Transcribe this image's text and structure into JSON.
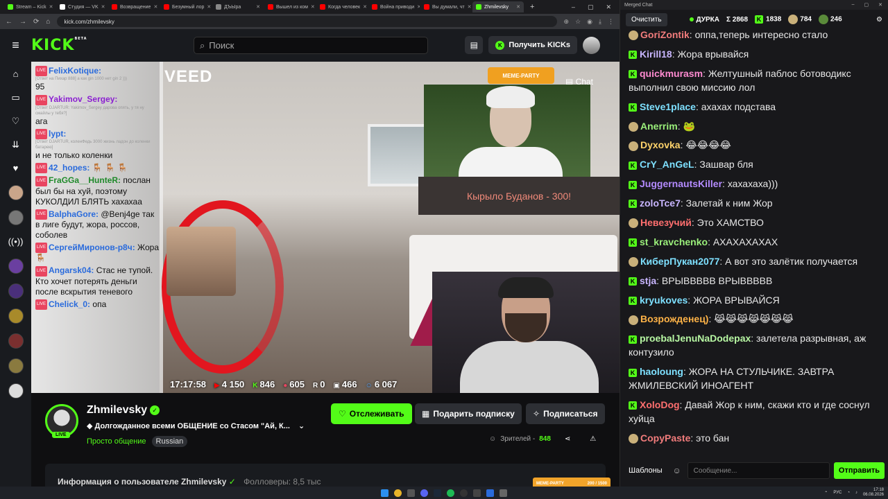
{
  "browser": {
    "tabs": [
      {
        "label": "Stream – Kick",
        "color": "#53fc18"
      },
      {
        "label": "Студия — VK",
        "color": "#ffffff"
      },
      {
        "label": "Возвращение",
        "color": "#ff0000"
      },
      {
        "label": "Безумный лор",
        "color": "#ff0000"
      },
      {
        "label": "ДЪЫра",
        "color": "#888888"
      },
      {
        "label": "Вышел из ком",
        "color": "#ff0000"
      },
      {
        "label": "Когда человек",
        "color": "#ff0000"
      },
      {
        "label": "Война приводи",
        "color": "#ff0000"
      },
      {
        "label": "Вы думали, чт",
        "color": "#ff0000"
      },
      {
        "label": "Zhmilevsky",
        "color": "#53fc18",
        "active": true
      }
    ],
    "url": "kick.com/zhmilevsky"
  },
  "kick": {
    "logo": "KICK",
    "logo_beta": "BETA",
    "search_placeholder": "Поиск",
    "get_kicks_label": "Получить KICKs"
  },
  "player": {
    "watermark": "VEED",
    "meme_party": "MEME-PARTY",
    "chat_label": "Chat",
    "caption": "Кырыло Буданов - 300!",
    "stats": {
      "time": "17:17:58",
      "youtube": "4 150",
      "kick": "846",
      "vklive": "605",
      "rutube": "0",
      "twitch": "466",
      "total": "6 067"
    },
    "overlay_chat": [
      {
        "user": "FelixKotique:",
        "color": "#2a6bdc",
        "quote": "[Ответ на Пихар 888] а как gin 1000 нет gin 2 )))",
        "text": "95"
      },
      {
        "user": "Yakimov_Sergey:",
        "color": "#8b1fd1",
        "quote": "[Ответ DJARTUR: Yakimov_Sergey дарова опять, у тя ну смайлы у тебя?]",
        "text": "ага"
      },
      {
        "user": "lypt:",
        "color": "#2a6bdc",
        "quote": "[Ответ DJARTUR, коленФедь 3000 жизнь ладон до коленки батарею]",
        "text": "и не только коленки"
      },
      {
        "user": "42_hopes:",
        "color": "#2a6bdc",
        "quote": "",
        "text": "🪑 🪑 🪑"
      },
      {
        "user": "FraGGa__HunteR:",
        "color": "#1f8a2a",
        "quote": "",
        "text": "послан был бы на хуй, поэтому КУКОЛДИЛ БЛЯТЬ хахахаа"
      },
      {
        "user": "BalphaGore:",
        "color": "#2a6bdc",
        "quote": "",
        "text": "@Benj4ge так в лиге будут, жора, россов, соболев"
      },
      {
        "user": "СергейМиронов-р8ч:",
        "color": "#2a6bdc",
        "quote": "",
        "text": "Жора 🪑"
      },
      {
        "user": "Angarsk04:",
        "color": "#2a6bdc",
        "quote": "",
        "text": "Стас не тупой. Кто хочет потерять деньги после вскрытия теневого"
      },
      {
        "user": "Chelick_0:",
        "color": "#2a6bdc",
        "quote": "",
        "text": "опа"
      }
    ]
  },
  "channel": {
    "name": "Zhmilevsky",
    "live_badge": "LIVE",
    "title": "Долгожданное всеми ОБЩЕНИЕ со Стасом \"Ай, К...",
    "category": "Просто общение",
    "language": "Russian",
    "follow_label": "Отслеживать",
    "gift_label": "Подарить подписку",
    "subscribe_label": "Подписаться",
    "viewers_label": "Зрителей -",
    "viewers_count": "848",
    "about_text": "Информация о пользователе Zhmilevsky",
    "about_followers": "Фолловеры: 8,5 тыс"
  },
  "merged_chat": {
    "window_title": "Merged Chat",
    "clear_label": "Очистить",
    "channel": "ДУРКА",
    "stat_total": "2868",
    "stat_kick": "1838",
    "stat_a": "784",
    "stat_b": "246",
    "templates_label": "Шаблоны",
    "input_placeholder": "Сообщение...",
    "send_label": "Отправить",
    "messages": [
      {
        "badge": "emote",
        "user": "GoriZontik",
        "color": "#f27c7c",
        "text": "оппа,теперь интересно стало"
      },
      {
        "badge": "kick",
        "user": "Kirill18",
        "color": "#c9b6ff",
        "text": "Жора врывайся"
      },
      {
        "badge": "kick",
        "user": "quickmurasm",
        "color": "#ff8bd1",
        "text": "Желтушный паблос ботоводикс выполнил свою миссию лол"
      },
      {
        "badge": "kick",
        "user": "Steve1place",
        "color": "#7ee0ff",
        "text": "ахахах подстава"
      },
      {
        "badge": "emote",
        "user": "Anerrim",
        "color": "#9bf07b",
        "text": "🐸"
      },
      {
        "badge": "emote",
        "user": "Dyxovka",
        "color": "#ffd36b",
        "text": "😂😂😂😂"
      },
      {
        "badge": "kick",
        "user": "CrY_AnGeL",
        "color": "#7ee0ff",
        "text": "Зашвар бля"
      },
      {
        "badge": "kick",
        "user": "JuggernautsKiller",
        "color": "#b48bff",
        "text": "хахахаха)))"
      },
      {
        "badge": "kick",
        "user": "zoloTce7",
        "color": "#c9b6ff",
        "text": "Залетай к ним Жор"
      },
      {
        "badge": "emote",
        "user": "Невезучий",
        "color": "#ff6f6f",
        "text": "Это ХАМСТВО"
      },
      {
        "badge": "kick",
        "user": "st_kravchenko",
        "color": "#9bf07b",
        "text": "АХАХАХАХАХ"
      },
      {
        "badge": "emote",
        "user": "КиберПукан2077",
        "color": "#7ee0ff",
        "text": "А вот это залётик получается"
      },
      {
        "badge": "kick",
        "user": "stja",
        "color": "#c9b6ff",
        "text": "ВРЫВВВВВ ВРЫВВВВВ"
      },
      {
        "badge": "kick",
        "user": "kryukoves",
        "color": "#7ee0ff",
        "text": "ЖОРА ВРЫВАЙСЯ"
      },
      {
        "badge": "emote",
        "user": "Возрожденец)",
        "color": "#ffb347",
        "text": "😹😹😹😹😹😹😹"
      },
      {
        "badge": "kick",
        "user": "proebalJenuNaDodepax",
        "color": "#b7f7a3",
        "text": "залетела разрывная, аж контузило"
      },
      {
        "badge": "kick",
        "user": "haoloung",
        "color": "#7ee0ff",
        "text": "ЖОРА НА СТУЛЬЧИКЕ. ЗАВТРА ЖМИЛЕВСКИЙ ИНОАГЕНТ"
      },
      {
        "badge": "kick",
        "user": "XoloDog",
        "color": "#ff6f6f",
        "text": "Давай Жор к ним, скажи кто и где соснул хуйца"
      },
      {
        "badge": "emote",
        "user": "CopyPaste",
        "color": "#f27c7c",
        "text": "это бан"
      }
    ]
  },
  "taskbar": {
    "meme_party": "MEME-PARTY",
    "meme_progress": "200 / 1500",
    "lang": "РУС",
    "time": "17:18",
    "date": "06.08.2026"
  }
}
